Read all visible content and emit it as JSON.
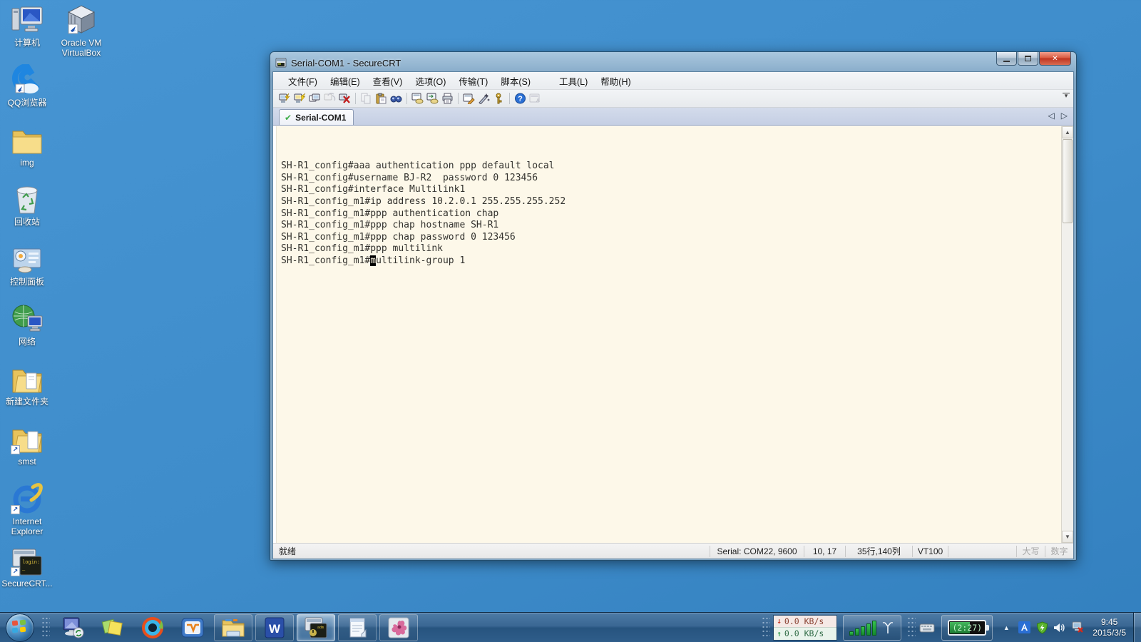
{
  "desktop": {
    "icons": [
      {
        "label": "计算机",
        "icon": "computer-icon"
      },
      {
        "label": "Oracle VM VirtualBox",
        "icon": "virtualbox-icon"
      },
      {
        "label": "QQ浏览器",
        "icon": "qq-browser-icon"
      },
      {
        "label": "img",
        "icon": "folder-icon"
      },
      {
        "label": "回收站",
        "icon": "recycle-bin-icon"
      },
      {
        "label": "控制面板",
        "icon": "control-panel-icon"
      },
      {
        "label": "网络",
        "icon": "network-icon"
      },
      {
        "label": "新建文件夹",
        "icon": "folder-icon"
      },
      {
        "label": "smst",
        "icon": "folder-shortcut-icon"
      },
      {
        "label": "Internet Explorer",
        "icon": "ie-icon"
      },
      {
        "label": "SecureCRT...",
        "icon": "securecrt-shortcut-icon"
      }
    ]
  },
  "window": {
    "title": "Serial-COM1 - SecureCRT",
    "menus": [
      "文件(F)",
      "编辑(E)",
      "查看(V)",
      "选项(O)",
      "传输(T)",
      "脚本(S)",
      "工具(L)",
      "帮助(H)"
    ],
    "toolbar_icons": [
      "connect",
      "quick-connect",
      "connect-in-tab",
      "reconnect",
      "disconnect",
      "copy",
      "paste",
      "find",
      "new-session-window",
      "clone-session",
      "print",
      "session-options",
      "global-options",
      "ssh-key",
      "help",
      "web-help"
    ],
    "tab": {
      "label": "Serial-COM1"
    },
    "terminal": {
      "lines": [
        "SH-R1_config#aaa authentication ppp default local",
        "SH-R1_config#username BJ-R2  password 0 123456",
        "SH-R1_config#interface Multilink1",
        "SH-R1_config_m1#ip address 10.2.0.1 255.255.255.252",
        "SH-R1_config_m1#ppp authentication chap",
        "SH-R1_config_m1#ppp chap hostname SH-R1",
        "SH-R1_config_m1#ppp chap password 0 123456",
        "SH-R1_config_m1#ppp multilink",
        "SH-R1_config_m1#multilink-group 1"
      ],
      "cursor": {
        "row": 8,
        "col": 16
      },
      "bg_color": "#fdf8e9",
      "text_color": "#33322e"
    },
    "statusbar": {
      "ready": "就绪",
      "serial": "Serial: COM22, 9600",
      "position": "10, 17",
      "size": "35行,140列",
      "emulation": "VT100",
      "caps_label": "大写",
      "num_label": "数字"
    }
  },
  "taskbar": {
    "pinned": [
      "remote-desktop",
      "sticky-notes",
      "media-app",
      "vm-app"
    ],
    "buttons": [
      "explorer",
      "word",
      "securecrt",
      "notepad",
      "flower-app"
    ],
    "active_button": "securecrt",
    "tray": {
      "download_speed": "0.0 KB/s",
      "upload_speed": "0.0 KB/s",
      "battery_time": "(2:27)",
      "time": "9:45",
      "date": "2015/3/5"
    }
  },
  "colors": {
    "desktop_blue": "#3e8cca",
    "terminal_bg": "#fdf8e9",
    "taskbar_blue": "#35608c",
    "tab_check_green": "#3fae49",
    "close_button_red": "#bf3520"
  }
}
